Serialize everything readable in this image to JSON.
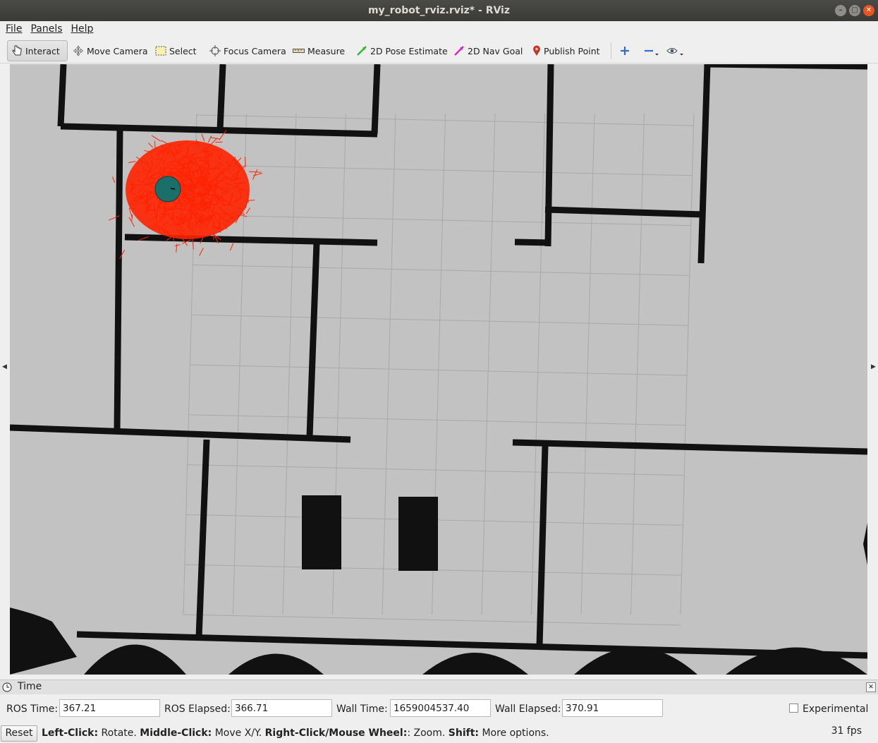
{
  "window": {
    "title": "my_robot_rviz.rviz* - RViz"
  },
  "menubar": {
    "items": [
      "File",
      "Panels",
      "Help"
    ]
  },
  "toolbar": {
    "interact": "Interact",
    "move_camera": "Move Camera",
    "select": "Select",
    "focus_camera": "Focus Camera",
    "measure": "Measure",
    "pose_estimate": "2D Pose Estimate",
    "nav_goal": "2D Nav Goal",
    "publish_point": "Publish Point"
  },
  "colors": {
    "particle_cloud": "#ff2200",
    "robot": "#1b6f6a",
    "map_free": "#c2c2c2",
    "map_occupied": "#111111",
    "grid": "#a8a8a8",
    "pose_estimate_icon": "#2db82d",
    "nav_goal_icon": "#e020c0",
    "publish_point_icon": "#c0392b"
  },
  "time_panel": {
    "title": "Time",
    "ros_time_label": "ROS Time:",
    "ros_time_value": "367.21",
    "ros_elapsed_label": "ROS Elapsed:",
    "ros_elapsed_value": "366.71",
    "wall_time_label": "Wall Time:",
    "wall_time_value": "1659004537.40",
    "wall_elapsed_label": "Wall Elapsed:",
    "wall_elapsed_value": "370.91",
    "experimental_label": "Experimental"
  },
  "statusbar": {
    "reset_label": "Reset",
    "left_click": "Left-Click:",
    "left_click_action": "Rotate.",
    "middle_click": "Middle-Click:",
    "middle_click_action": "Move X/Y.",
    "right_click": "Right-Click/Mouse Wheel:",
    "right_click_action": ": Zoom.",
    "shift": "Shift:",
    "shift_action": "More options.",
    "fps": "31 fps"
  }
}
